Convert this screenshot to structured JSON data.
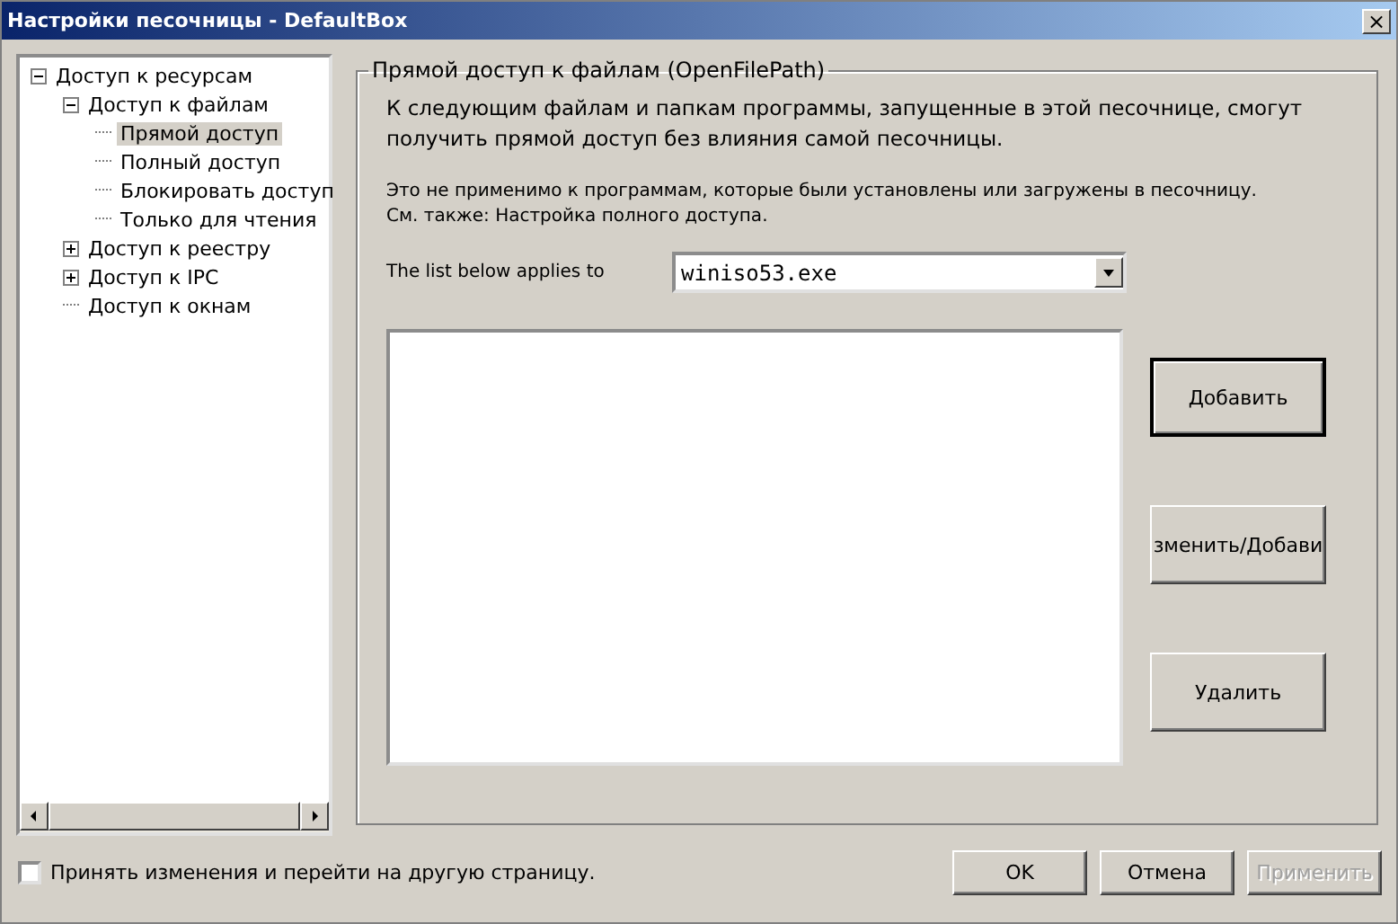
{
  "window": {
    "title": "Настройки песочницы - DefaultBox",
    "close": "×"
  },
  "tree": [
    {
      "label": "Доступ к ресурсам",
      "expanded": true,
      "selected": false,
      "children": [
        {
          "label": "Доступ к файлам",
          "expanded": true,
          "selected": false,
          "children": [
            {
              "label": "Прямой доступ",
              "selected": true
            },
            {
              "label": "Полный доступ",
              "selected": false
            },
            {
              "label": "Блокировать доступ",
              "selected": false
            },
            {
              "label": "Только для чтения",
              "selected": false
            }
          ]
        },
        {
          "label": "Доступ к реестру",
          "expanded": false,
          "selected": false
        },
        {
          "label": "Доступ к IPC",
          "expanded": false,
          "selected": false
        },
        {
          "label": "Доступ к окнам",
          "selected": false
        }
      ]
    }
  ],
  "group": {
    "title": "Прямой доступ к файлам (OpenFilePath)",
    "intro": "К следующим файлам и папкам программы, запущенные в этой песочнице, смогут получить прямой доступ без влияния самой песочницы.",
    "note": "Это не применимо к программам, которые были установлены или загружены в песочницу.",
    "see_also": "См. также:  Настройка полного доступа.",
    "applies_label": "The list below applies to",
    "applies_value": "winiso53.exe",
    "buttons": [
      {
        "label": "Добавить",
        "default": true
      },
      {
        "label": "зменить/Добави",
        "default": false
      },
      {
        "label": "Удалить",
        "default": false
      }
    ]
  },
  "accept": {
    "label": "Принять изменения и перейти на другую страницу.",
    "checked": false
  },
  "footer_buttons": [
    {
      "label": "OK",
      "disabled": false
    },
    {
      "label": "Отмена",
      "disabled": false
    },
    {
      "label": "Применить",
      "disabled": true
    }
  ]
}
